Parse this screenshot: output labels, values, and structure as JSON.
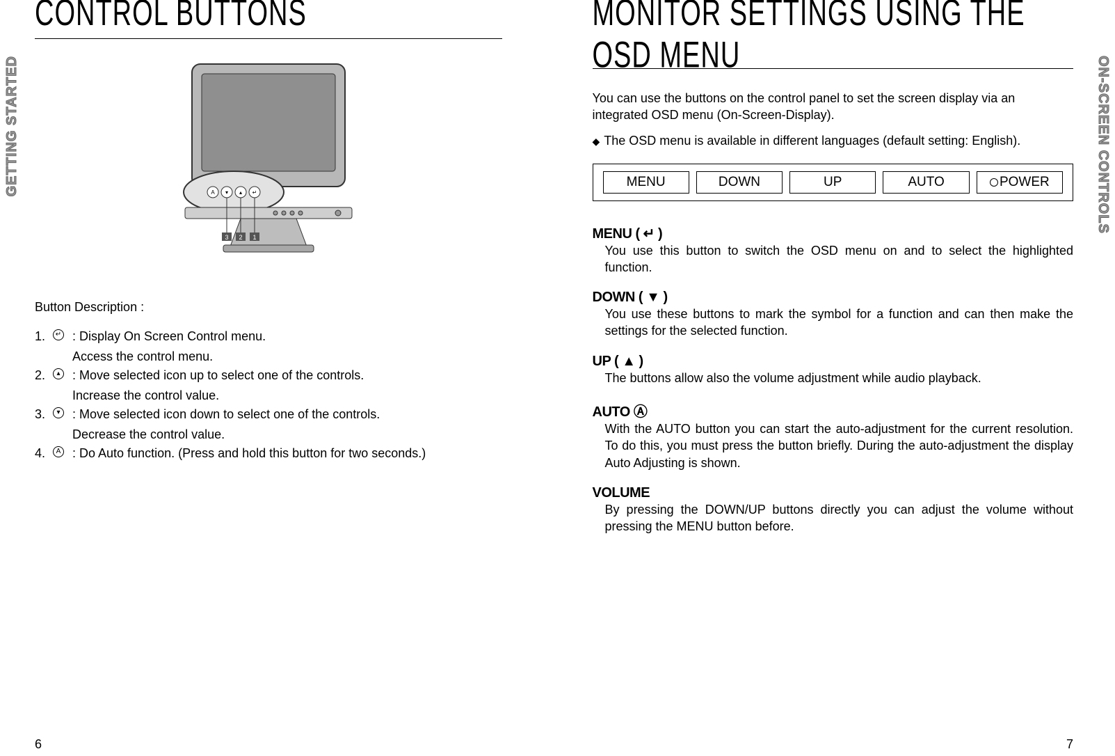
{
  "left": {
    "heading": "CONTROL BUTTONS",
    "side_tab": "GETTING STARTED",
    "desc_title": "Button Description :",
    "items": [
      {
        "num": "1.",
        "icon": "enter-icon",
        "line1": ": Display On Screen Control menu.",
        "line2": "Access the control menu."
      },
      {
        "num": "2.",
        "icon": "up-icon",
        "line1": ": Move selected icon up to select one of the controls.",
        "line2": "Increase the control value."
      },
      {
        "num": "3.",
        "icon": "down-icon",
        "line1": ": Move selected icon down to select one of the controls.",
        "line2": "Decrease the control value."
      },
      {
        "num": "4.",
        "icon": "auto-icon",
        "line1": ": Do Auto function. (Press and hold this button for two seconds.)",
        "line2": ""
      }
    ],
    "pagenum": "6"
  },
  "right": {
    "heading": "MONITOR SETTINGS USING THE OSD MENU",
    "side_tab": "ON-SCREEN CONTROLS",
    "intro": "You can use the buttons on the control panel to set the screen display via an integrated OSD menu (On-Screen-Display).",
    "note": "The OSD menu is available in different languages (default setting: English).",
    "buttons": [
      "MENU",
      "DOWN",
      "UP",
      "AUTO",
      "POWER"
    ],
    "terms": [
      {
        "title": "MENU ( ↵ )",
        "body": "You use this button to switch the OSD menu on and to select the highlighted function."
      },
      {
        "title": "DOWN ( ▼ )",
        "body": "You use these buttons to mark the symbol for a function and can then make the settings for the selected function."
      },
      {
        "title": "UP ( ▲ )",
        "body": "The buttons allow also the volume adjustment while audio playback."
      },
      {
        "title": "AUTO  Ⓐ",
        "body": "With the AUTO button you can start the auto-adjustment for the current resolution. To do this, you must press the button briefly. During the auto-adjustment the display Auto Adjusting is shown."
      },
      {
        "title": "VOLUME",
        "body": "By pressing the DOWN/UP buttons directly you can adjust the volume without pressing the MENU button before."
      }
    ],
    "pagenum": "7"
  }
}
